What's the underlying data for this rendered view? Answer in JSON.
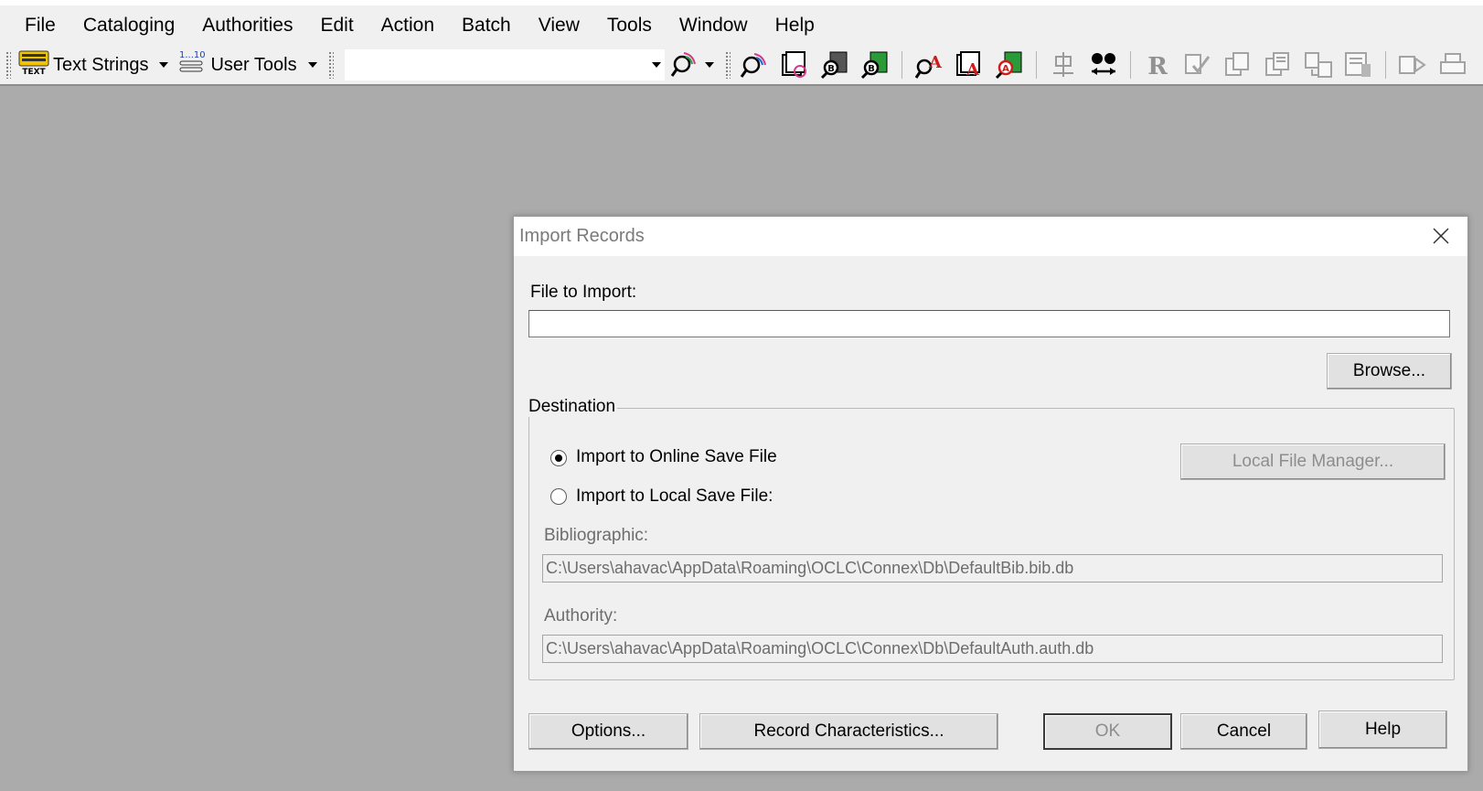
{
  "menu": [
    "File",
    "Cataloging",
    "Authorities",
    "Edit",
    "Action",
    "Batch",
    "View",
    "Tools",
    "Window",
    "Help"
  ],
  "toolbar": {
    "text_strings_label": "Text Strings",
    "user_tools_label": "User Tools",
    "text_strings_icon": "text-strings-icon",
    "user_tools_icon": "user-tools-icon"
  },
  "dialog": {
    "title": "Import Records",
    "file_to_import_label": "File to Import:",
    "file_to_import_value": "",
    "browse_button": "Browse...",
    "destination_legend": "Destination",
    "radio_online": "Import to Online Save File",
    "radio_local": "Import to Local Save File:",
    "selected_destination": "Import to Online Save File",
    "local_file_manager_button": "Local File Manager...",
    "bibliographic_label": "Bibliographic:",
    "bibliographic_value": "C:\\Users\\ahavac\\AppData\\Roaming\\OCLC\\Connex\\Db\\DefaultBib.bib.db",
    "authority_label": "Authority:",
    "authority_value": "C:\\Users\\ahavac\\AppData\\Roaming\\OCLC\\Connex\\Db\\DefaultAuth.auth.db",
    "options_button": "Options...",
    "record_characteristics_button": "Record Characteristics...",
    "ok_button": "OK",
    "cancel_button": "Cancel",
    "help_button": "Help"
  },
  "colors": {
    "workspace": "#ababab",
    "chrome": "#f0f0f0",
    "disabled_text": "#8d8d8d"
  }
}
